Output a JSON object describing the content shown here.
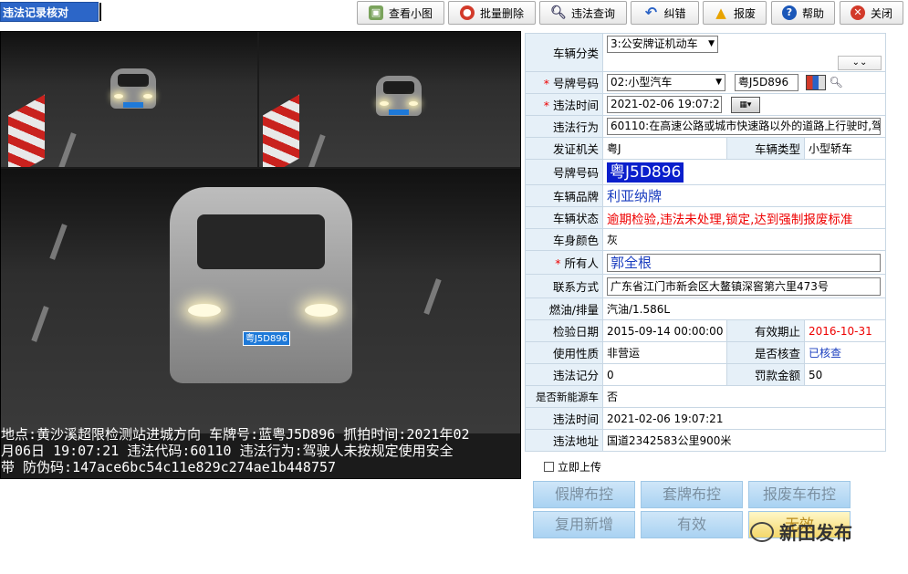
{
  "title": "违法记录核对",
  "toolbar": {
    "view_thumbnail": "查看小图",
    "batch_delete": "批量删除",
    "violation_query": "违法查询",
    "correct": "纠错",
    "report_scrap": "报废",
    "help": "帮助",
    "close": "关闭"
  },
  "photo": {
    "plate_text": "粤J5D896",
    "caption_line1": "地点:黄沙溪超限检测站进城方向 车牌号:蓝粤J5D896 抓拍时间:2021年02",
    "caption_line2": "月06日 19:07:21 违法代码:60110 违法行为:驾驶人未按规定使用安全",
    "caption_line3": "带 防伪码:147ace6bc54c11e829c274ae1b448757"
  },
  "form": {
    "vehicle_category_label": "车辆分类",
    "vehicle_category_value": "3:公安牌证机动车",
    "plate_type_label": "号牌号码",
    "plate_type_value": "02:小型汽车",
    "plate_number_value": "粤J5D896",
    "violation_time_label": "违法时间",
    "violation_time_value": "2021-02-06 19:07:21",
    "violation_behavior_label": "违法行为",
    "violation_behavior_value": "60110:在高速公路或城市快速路以外的道路上行驶时,驾",
    "issuing_authority_label": "发证机关",
    "issuing_authority_value": "粤J",
    "vehicle_type_label": "车辆类型",
    "vehicle_type_value": "小型轿车",
    "plate_number_label": "号牌号码",
    "plate_number_display": "粤J5D896",
    "vehicle_brand_label": "车辆品牌",
    "vehicle_brand_value": "利亚纳牌",
    "vehicle_status_label": "车辆状态",
    "vehicle_status_value": "逾期检验,违法未处理,锁定,达到强制报废标准",
    "body_color_label": "车身颜色",
    "body_color_value": "灰",
    "owner_label": "所有人",
    "owner_value": "郭全根",
    "contact_label": "联系方式",
    "contact_value": "广东省江门市新会区大鳌镇深窖第六里473号",
    "fuel_label": "燃油/排量",
    "fuel_value": "汽油/1.586L",
    "inspection_date_label": "检验日期",
    "inspection_date_value": "2015-09-14 00:00:00",
    "valid_until_label": "有效期止",
    "valid_until_value": "2016-10-31",
    "usage_label": "使用性质",
    "usage_value": "非营运",
    "verified_label": "是否核查",
    "verified_value": "已核查",
    "points_label": "违法记分",
    "points_value": "0",
    "fine_label": "罚款金额",
    "fine_value": "50",
    "new_energy_label": "是否新能源车",
    "new_energy_value": "否",
    "violation_time2_label": "违法时间",
    "violation_time2_value": "2021-02-06 19:07:21",
    "violation_location_label": "违法地址",
    "violation_location_value": "国道2342583公里900米"
  },
  "actions": {
    "upload_now": "立即上传",
    "fake_plate_control": "假牌布控",
    "cloned_plate_control": "套牌布控",
    "scrap_vehicle_control": "报废车布控",
    "reuse_add": "复用新增",
    "valid": "有效",
    "invalid": "无效"
  },
  "watermark": "新田发布"
}
